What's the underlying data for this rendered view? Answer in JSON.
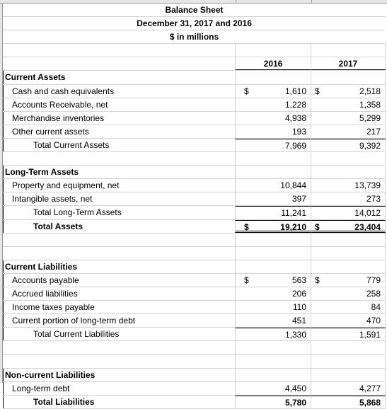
{
  "title": "Balance Sheet",
  "subtitle": "December 31, 2017 and 2016",
  "units": "$ in millions",
  "columns": [
    "2016",
    "2017"
  ],
  "currency_symbol": "$",
  "sections": {
    "current_assets": {
      "heading": "Current Assets",
      "items": [
        {
          "label": "Cash and cash equivalents",
          "v2016": "1,610",
          "v2017": "2,518"
        },
        {
          "label": "Accounts Receivable, net",
          "v2016": "1,228",
          "v2017": "1,358"
        },
        {
          "label": "Merchandise inventories",
          "v2016": "4,938",
          "v2017": "5,299"
        },
        {
          "label": "Other current assets",
          "v2016": "193",
          "v2017": "217"
        }
      ],
      "total": {
        "label": "Total Current Assets",
        "v2016": "7,969",
        "v2017": "9,392"
      }
    },
    "long_term_assets": {
      "heading": "Long-Term Assets",
      "items": [
        {
          "label": "Property and equipment, net",
          "v2016": "10,844",
          "v2017": "13,739"
        },
        {
          "label": "Intangible assets, net",
          "v2016": "397",
          "v2017": "273"
        }
      ],
      "total": {
        "label": "Total Long-Term Assets",
        "v2016": "11,241",
        "v2017": "14,012"
      },
      "grand_total": {
        "label": "Total Assets",
        "v2016": "19,210",
        "v2017": "23,404"
      }
    },
    "current_liabilities": {
      "heading": "Current Liabilities",
      "items": [
        {
          "label": "Accounts payable",
          "v2016": "563",
          "v2017": "779"
        },
        {
          "label": "Accrued liabilities",
          "v2016": "206",
          "v2017": "258"
        },
        {
          "label": "Income taxes payable",
          "v2016": "110",
          "v2017": "84"
        },
        {
          "label": "Current portion of long-term debt",
          "v2016": "451",
          "v2017": "470"
        }
      ],
      "total": {
        "label": "Total Current Liabilities",
        "v2016": "1,330",
        "v2017": "1,591"
      }
    },
    "noncurrent_liabilities": {
      "heading": "Non-current Liabilities",
      "items": [
        {
          "label": "Long-term debt",
          "v2016": "4,450",
          "v2017": "4,277"
        }
      ],
      "total": {
        "label": "Total Liabilities",
        "v2016": "5,780",
        "v2017": "5,868"
      }
    }
  }
}
